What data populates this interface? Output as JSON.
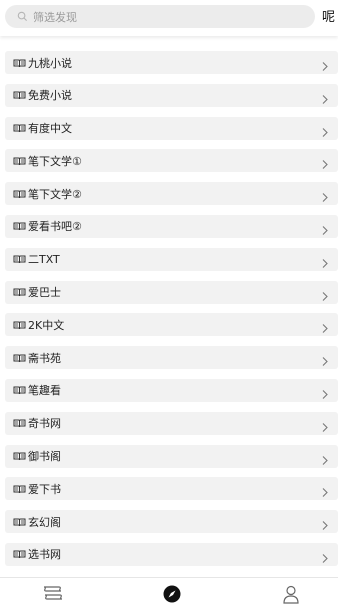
{
  "search": {
    "placeholder": "筛选发现"
  },
  "corner_button": {
    "label": "呢"
  },
  "sources": [
    {
      "label": "九桃小说"
    },
    {
      "label": "免费小说"
    },
    {
      "label": "有度中文"
    },
    {
      "label": "笔下文学①"
    },
    {
      "label": "笔下文学②"
    },
    {
      "label": "爱看书吧②"
    },
    {
      "label": "二TXT"
    },
    {
      "label": "爱巴士"
    },
    {
      "label": "2K中文"
    },
    {
      "label": "斋书苑"
    },
    {
      "label": "笔趣看"
    },
    {
      "label": "奇书网"
    },
    {
      "label": "御书阁"
    },
    {
      "label": "爱下书"
    },
    {
      "label": "玄幻阁"
    },
    {
      "label": "选书网"
    }
  ],
  "icons": {
    "search": "search-icon",
    "row_left": "book-icon",
    "row_right": "chevron-right-icon",
    "tab_bookshelf": "bookshelf-icon",
    "tab_discover": "compass-icon",
    "tab_profile": "person-icon"
  },
  "colors": {
    "row_bg": "#f2f2f2",
    "search_bg": "#ececec",
    "active_tab": "#111111"
  }
}
